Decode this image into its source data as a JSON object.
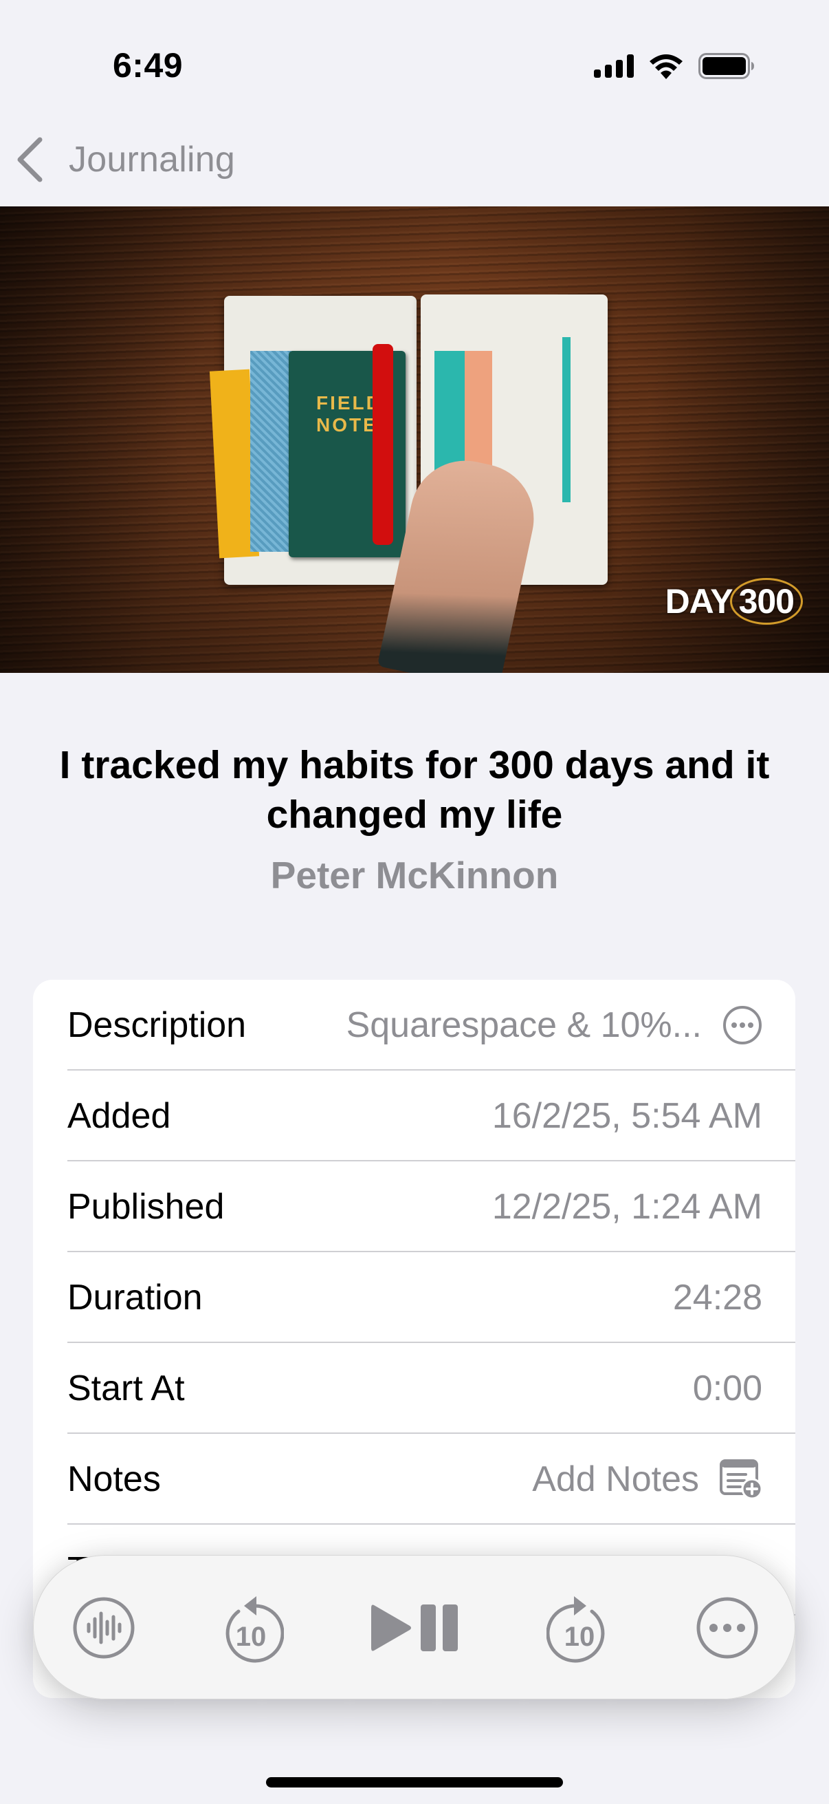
{
  "status_bar": {
    "time": "6:49",
    "icons": [
      "cellular-signal-icon",
      "wifi-icon",
      "battery-icon"
    ]
  },
  "nav": {
    "back_icon": "chevron-left-icon",
    "back_label": "Journaling"
  },
  "artwork": {
    "overlay_text": "DAY",
    "overlay_number": "300",
    "notebook_text": "FIELD NOTES"
  },
  "episode": {
    "title": "I tracked my habits for 300 days and it changed my life",
    "author": "Peter McKinnon"
  },
  "details": {
    "rows": [
      {
        "label": "Description",
        "value": "Squarespace & 10%...",
        "icon": "ellipsis-circle-icon"
      },
      {
        "label": "Added",
        "value": "16/2/25, 5:54 AM"
      },
      {
        "label": "Published",
        "value": "12/2/25, 1:24 AM"
      },
      {
        "label": "Duration",
        "value": "24:28"
      },
      {
        "label": "Start At",
        "value": "0:00"
      },
      {
        "label": "Notes",
        "value": "Add Notes",
        "icon": "note-add-icon"
      },
      {
        "label": "T",
        "value": ""
      }
    ]
  },
  "player": {
    "buttons": [
      {
        "name": "waveform",
        "icon": "waveform-circle-icon"
      },
      {
        "name": "skip-back",
        "icon": "gobackward-10-icon",
        "seconds": "10"
      },
      {
        "name": "play-pause",
        "icon": "play-pause-icon"
      },
      {
        "name": "skip-forward",
        "icon": "goforward-10-icon",
        "seconds": "10"
      },
      {
        "name": "more",
        "icon": "ellipsis-circle-icon"
      }
    ]
  },
  "colors": {
    "background": "#f2f2f7",
    "secondary_text": "#8e8e93",
    "primary_text": "#000000",
    "card": "#ffffff",
    "player_bg": "#f5f5f5"
  }
}
